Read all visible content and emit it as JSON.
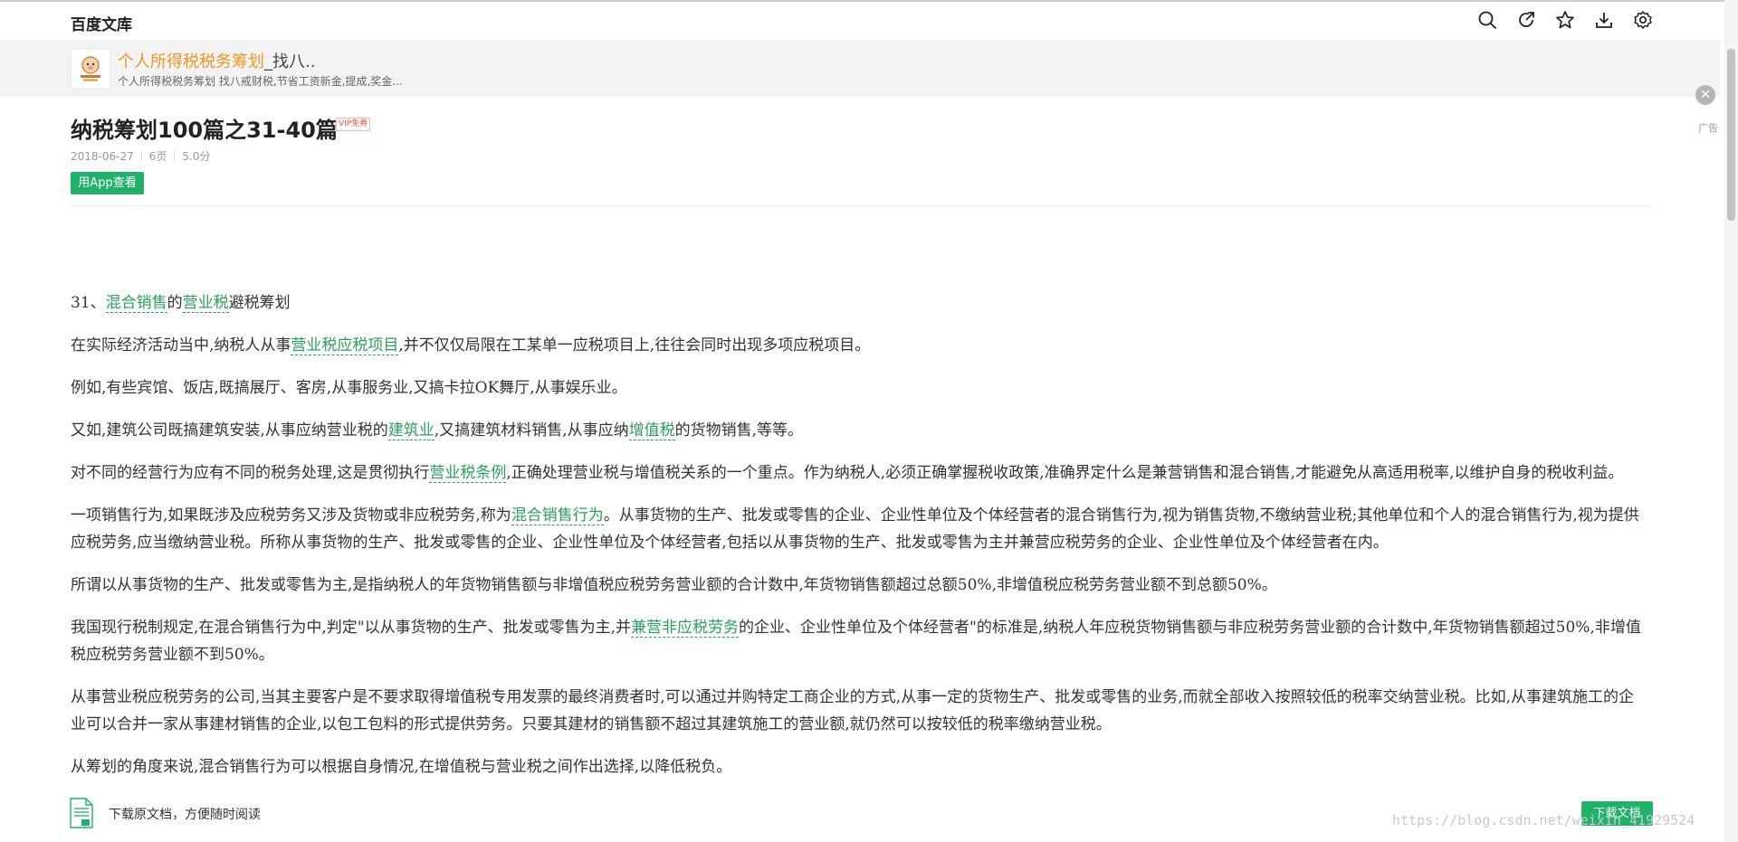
{
  "header": {
    "brand": "百度文库",
    "tools": [
      "search-icon",
      "share-icon",
      "star-icon",
      "download-icon",
      "settings-icon"
    ]
  },
  "ad": {
    "title_highlight": "个人所得税税务筹划",
    "title_rest": "_找八..",
    "description": "个人所得税税务筹划 找八戒财税,节省工资新金,提成,奖金...",
    "tag": "广告"
  },
  "doc": {
    "title": "纳税筹划100篇之31-40篇",
    "vip_badge": "VIP免券",
    "date": "2018-06-27",
    "pages": "6页",
    "score": "5.0分",
    "app_button": "用App查看"
  },
  "content": {
    "heading": {
      "prefix": "31、",
      "link1": "混合销售",
      "mid": "的",
      "link2": "营业税",
      "suffix": "避税筹划"
    },
    "p1": {
      "a": "在实际经济活动当中,纳税人从事",
      "link": "营业税应税项目",
      "b": ",并不仅仅局限在工某单一应税项目上,往往会同时出现多项应税项目。"
    },
    "p2": "例如,有些宾馆、饭店,既搞展厅、客房,从事服务业,又搞卡拉OK舞厅,从事娱乐业。",
    "p3": {
      "a": "又如,建筑公司既搞建筑安装,从事应纳营业税的",
      "link1": "建筑业",
      "b": ",又搞建筑材料销售,从事应纳",
      "link2": "增值税",
      "c": "的货物销售,等等。"
    },
    "p4": {
      "a": "对不同的经营行为应有不同的税务处理,这是贯彻执行",
      "link": "营业税条例",
      "b": ",正确处理营业税与增值税关系的一个重点。作为纳税人,必须正确掌握税收政策,准确界定什么是兼营销售和混合销售,才能避免从高适用税率,以维护自身的税收利益。"
    },
    "p5": {
      "a": "一项销售行为,如果既涉及应税劳务又涉及货物或非应税劳务,称为",
      "link": "混合销售行为",
      "b": "。从事货物的生产、批发或零售的企业、企业性单位及个体经营者的混合销售行为,视为销售货物,不缴纳营业税;其他单位和个人的混合销售行为,视为提供应税劳务,应当缴纳营业税。所称从事货物的生产、批发或零售的企业、企业性单位及个体经营者,包括以从事货物的生产、批发或零售为主并兼营应税劳务的企业、企业性单位及个体经营者在内。"
    },
    "p6": "所谓以从事货物的生产、批发或零售为主,是指纳税人的年货物销售额与非增值税应税劳务营业额的合计数中,年货物销售额超过总额50%,非增值税应税劳务营业额不到总额50%。",
    "p7": {
      "a": "我国现行税制规定,在混合销售行为中,判定\"以从事货物的生产、批发或零售为主,并",
      "link": "兼营非应税劳务",
      "b": "的企业、企业性单位及个体经营者\"的标准是,纳税人年应税货物销售额与非应税劳务营业额的合计数中,年货物销售额超过50%,非增值税应税劳务营业额不到50%。"
    },
    "p8": "从事营业税应税劳务的公司,当其主要客户是不要求取得增值税专用发票的最终消费者时,可以通过并购特定工商企业的方式,从事一定的货物生产、批发或零售的业务,而就全部收入按照较低的税率交纳营业税。比如,从事建筑施工的企业可以合并一家从事建材销售的企业,以包工包料的形式提供劳务。只要其建材的销售额不超过其建筑施工的营业额,就仍然可以按较低的税率缴纳营业税。",
    "p9": "从筹划的角度来说,混合销售行为可以根据自身情况,在增值税与营业税之间作出选择,以降低税负。"
  },
  "bottom": {
    "download_text": "下载原文档，方便随时阅读",
    "download_button": "下载文档",
    "watermark": "https://blog.csdn.net/weixin_41929524"
  },
  "colors": {
    "accent_green": "#21b26a",
    "link_green": "#2aa15a",
    "ad_orange": "#f39423"
  }
}
